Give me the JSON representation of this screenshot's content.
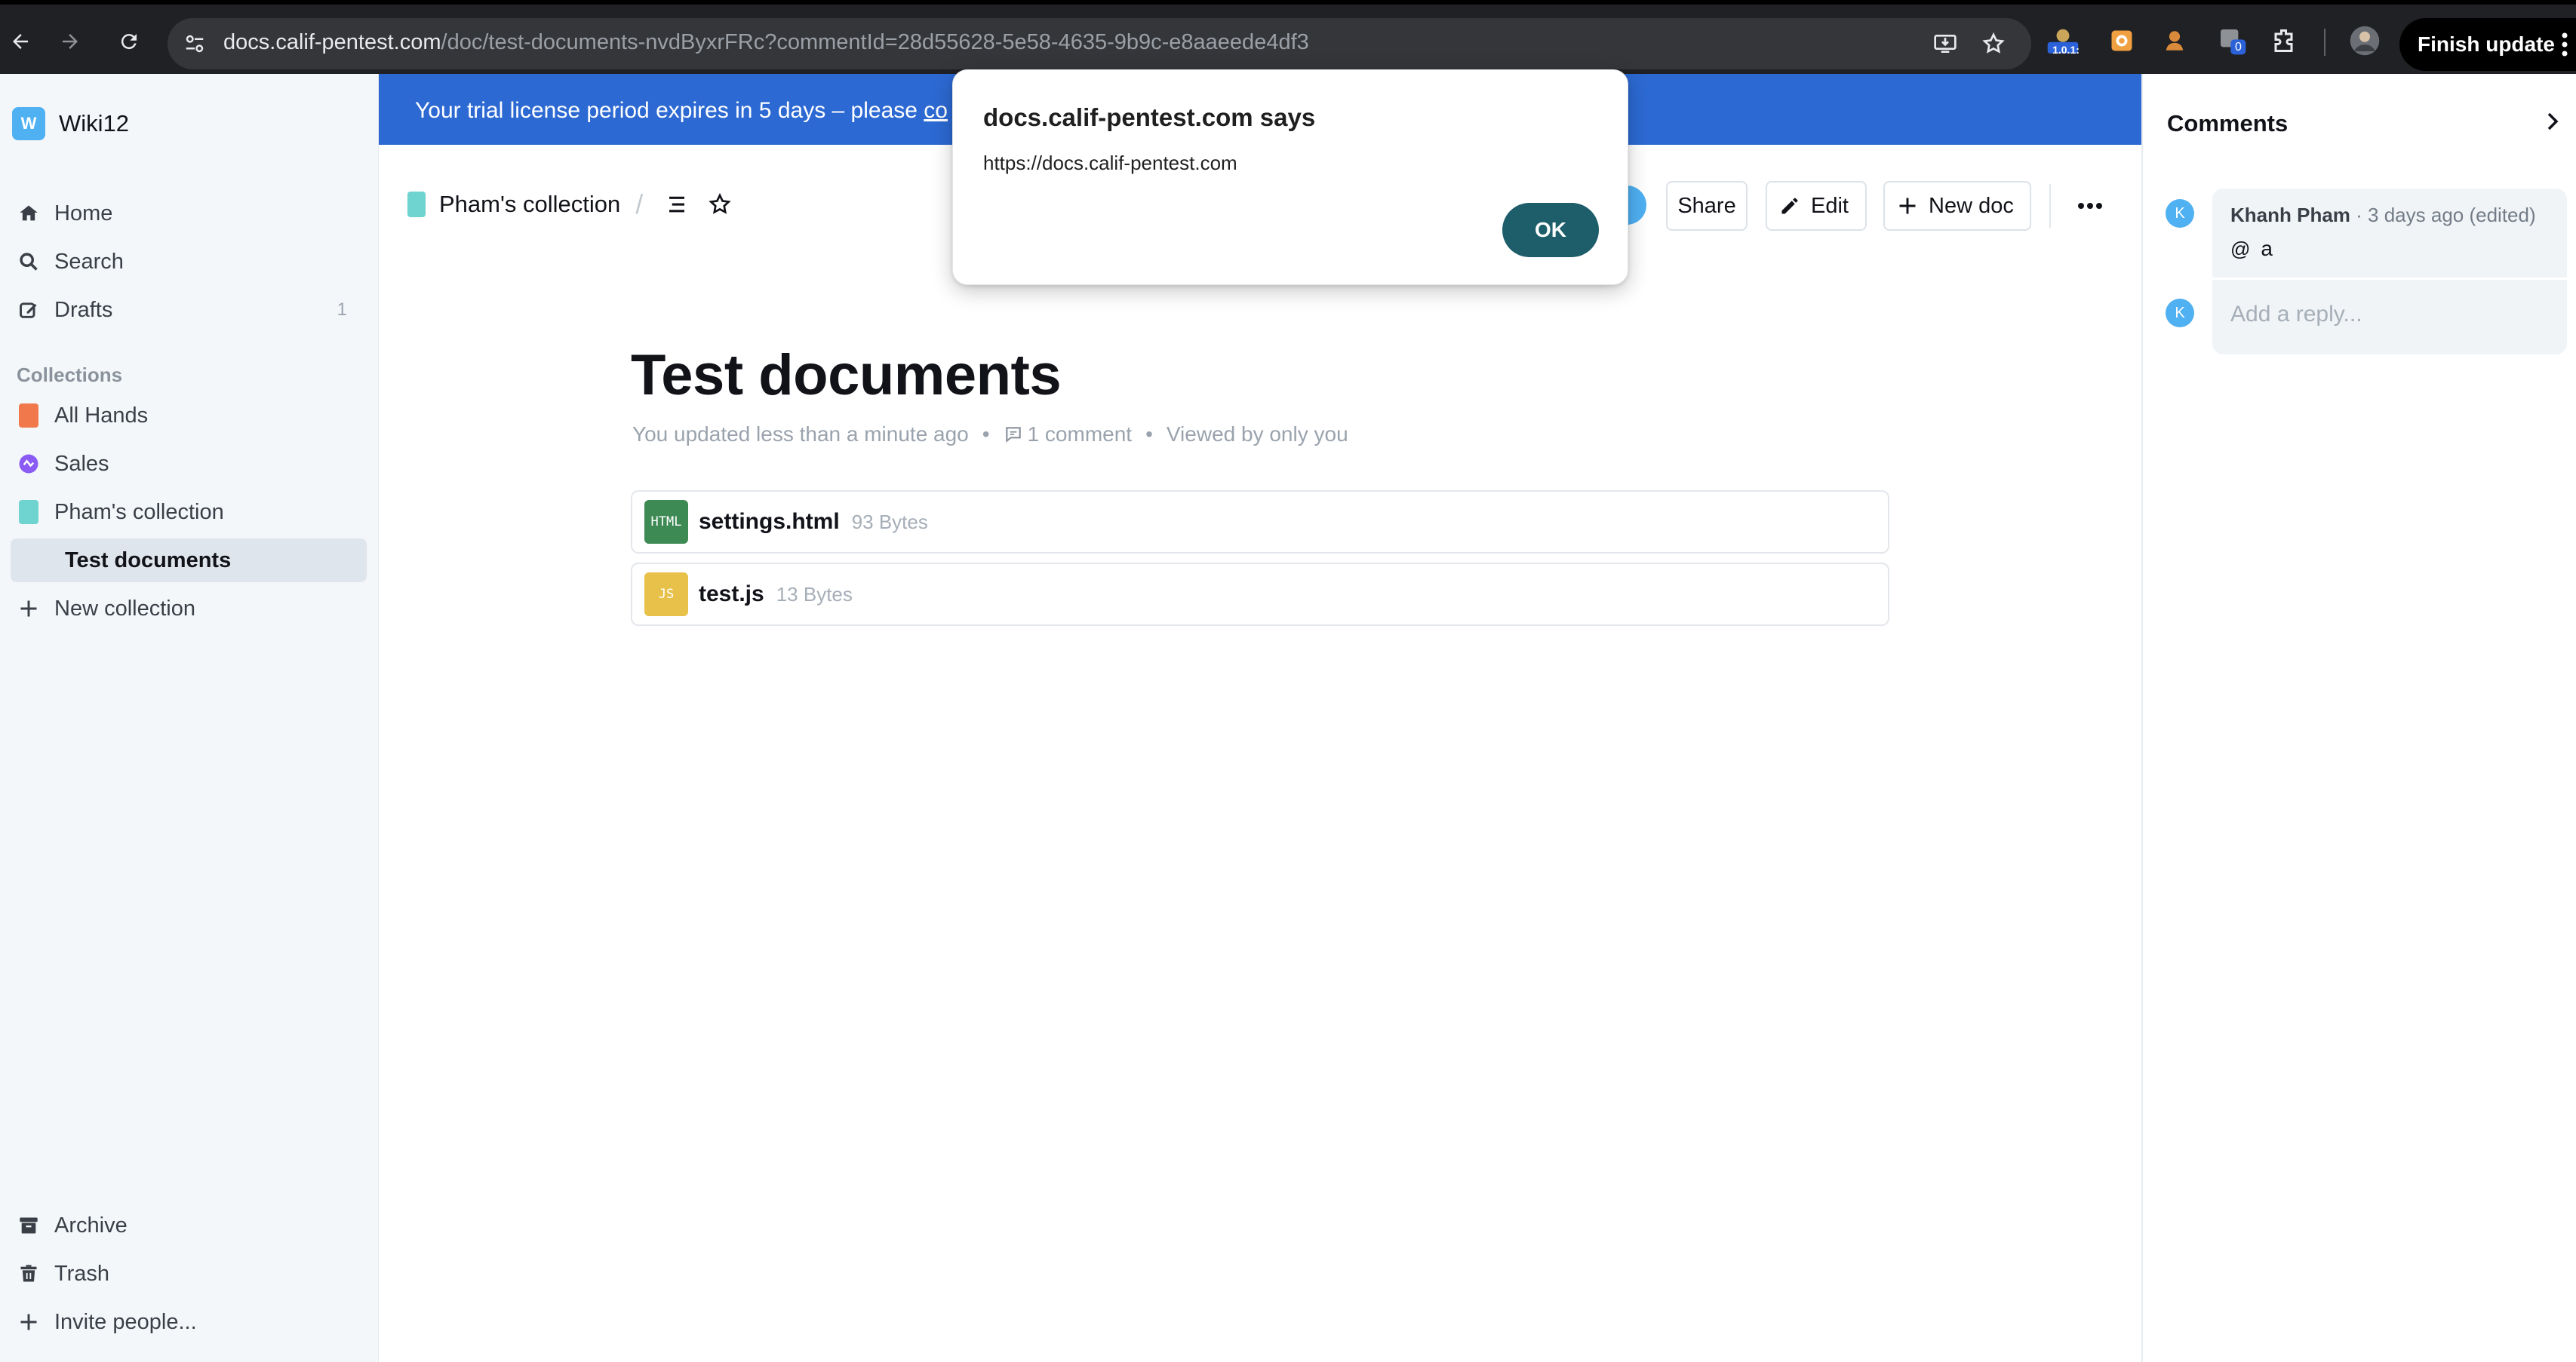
{
  "browser": {
    "url_host": "docs.calif-pentest.com",
    "url_path": "/doc/test-documents-nvdByxrFRc?commentId=28d55628-5e58-4635-9b9c-e8aaeede4df3",
    "ext_badge_label": "1.0.1:",
    "ext_counter": "0",
    "finish_update_label": "Finish update"
  },
  "sidebar": {
    "workspace_initial": "W",
    "workspace_name": "Wiki12",
    "nav": {
      "home": "Home",
      "search": "Search",
      "drafts": "Drafts",
      "drafts_count": "1"
    },
    "collections_heading": "Collections",
    "collections": [
      {
        "label": "All Hands",
        "color": "#f0784b"
      },
      {
        "label": "Sales",
        "color": "#8a5cf5"
      },
      {
        "label": "Pham's collection",
        "color": "#6fd3cf"
      }
    ],
    "active_doc": "Test documents",
    "new_collection": "New collection",
    "footer": {
      "archive": "Archive",
      "trash": "Trash",
      "invite": "Invite people..."
    }
  },
  "banner": {
    "text": "Your trial license period expires in 5 days – please ",
    "link": "co"
  },
  "header": {
    "breadcrumb_collection": "Pham's collection",
    "share": "Share",
    "edit": "Edit",
    "new_doc": "New doc"
  },
  "document": {
    "title": "Test documents",
    "updated": "You updated less than a minute ago",
    "comments": "1 comment",
    "viewed": "Viewed by only you",
    "attachments": [
      {
        "icon_label": "HTML",
        "name": "settings.html",
        "size": "93 Bytes",
        "color": "#3e8a55"
      },
      {
        "icon_label": "JS",
        "name": "test.js",
        "size": "13 Bytes",
        "color": "#e8c14a"
      }
    ]
  },
  "comments_panel": {
    "title": "Comments",
    "comment": {
      "avatar": "K",
      "author": "Khanh Pham",
      "meta": " · 3 days ago (edited)",
      "mention": "@",
      "text": "a"
    },
    "reply_avatar": "K",
    "reply_placeholder": "Add a reply..."
  },
  "dialog": {
    "title": "docs.calif-pentest.com says",
    "message": "https://docs.calif-pentest.com",
    "ok": "OK"
  }
}
